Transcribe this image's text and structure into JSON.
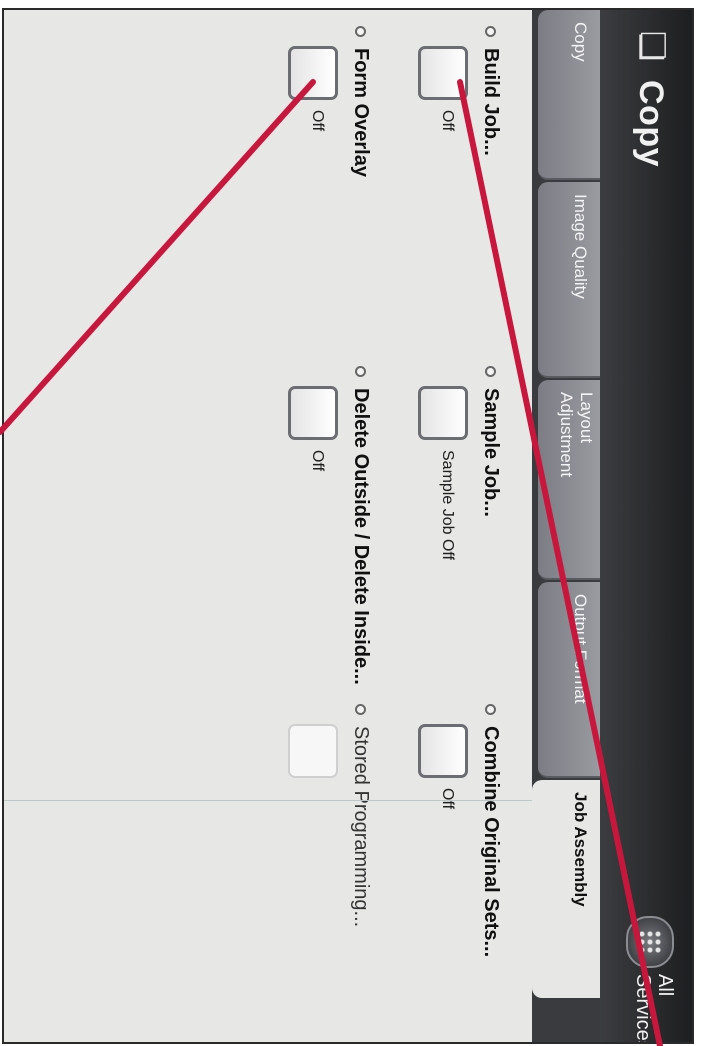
{
  "header": {
    "title": "Copy",
    "app_icon": "copy-app-icon",
    "all_services_label": "All Services"
  },
  "tabs": [
    {
      "label": "Copy"
    },
    {
      "label": "Image Quality"
    },
    {
      "label": "Layout\nAdjustment"
    },
    {
      "label": "Output Format"
    },
    {
      "label": "Job Assembly"
    }
  ],
  "options": {
    "build_job": {
      "label": "Build Job...",
      "state": "Off"
    },
    "sample_job": {
      "label": "Sample Job...",
      "state": "Sample Job Off"
    },
    "combine_original_sets": {
      "label": "Combine Original Sets...",
      "state": "Off"
    },
    "form_overlay": {
      "label": "Form Overlay",
      "state": "Off"
    },
    "delete_outside_inside": {
      "label": "Delete Outside / Delete Inside...",
      "state": "Off"
    },
    "stored_programming": {
      "label": "Stored Programming..."
    }
  },
  "colors": {
    "annotation_line": "#c8173c",
    "title_bar": "#2a2b2e",
    "panel": "#e7e8e6"
  }
}
